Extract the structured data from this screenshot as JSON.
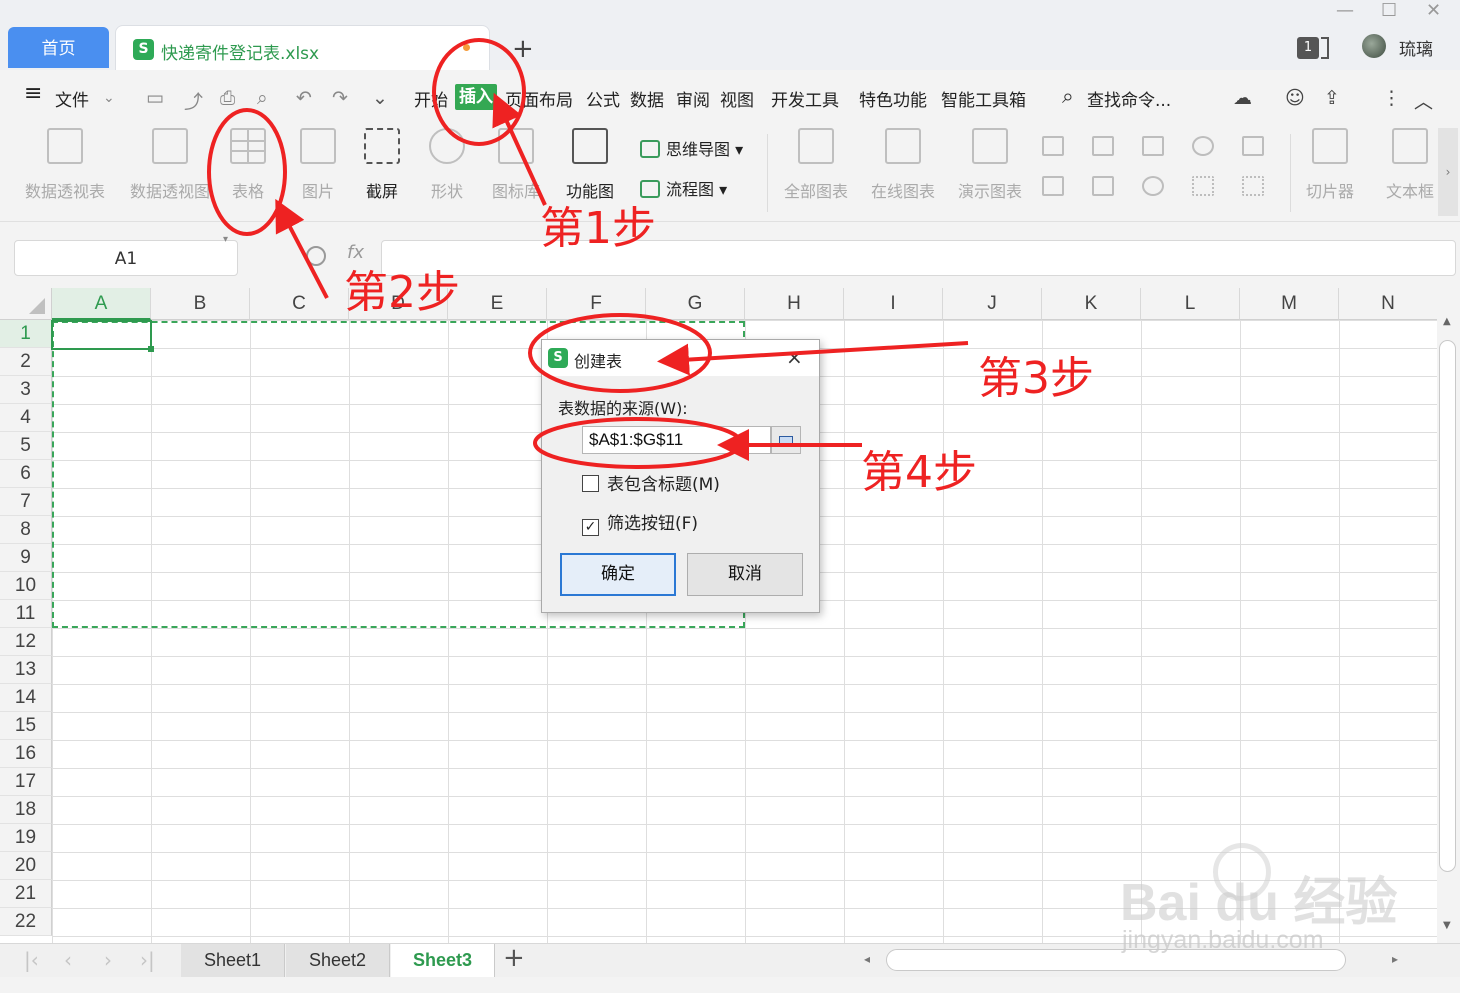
{
  "titlebar": {
    "home_tab": "首页",
    "file_tab": "快递寄件登记表.xlsx",
    "file_logo": "S",
    "add_tab": "+",
    "window_count": "1",
    "username": "琉璃"
  },
  "menu": {
    "hamburger": "≡",
    "file": "文件",
    "items": [
      "开始",
      "插入",
      "页面布局",
      "公式",
      "数据",
      "审阅",
      "视图",
      "开发工具",
      "特色功能",
      "智能工具箱"
    ],
    "search": "查找命令..."
  },
  "ribbon": {
    "buttons": [
      "数据透视表",
      "数据透视图",
      "表格",
      "图片",
      "截屏",
      "形状",
      "图标库",
      "功能图"
    ],
    "mindmap": "思维导图",
    "flowchart": "流程图",
    "chart_buttons": [
      "全部图表",
      "在线图表",
      "演示图表"
    ],
    "slicer": "切片器",
    "textbox": "文本框"
  },
  "formula": {
    "name_box": "A1",
    "fx_label": "fx",
    "value": ""
  },
  "grid": {
    "columns": [
      "A",
      "B",
      "C",
      "D",
      "E",
      "F",
      "G",
      "H",
      "I",
      "J",
      "K",
      "L",
      "M",
      "N"
    ],
    "rows": [
      "1",
      "2",
      "3",
      "4",
      "5",
      "6",
      "7",
      "8",
      "9",
      "10",
      "11",
      "12",
      "13",
      "14",
      "15",
      "16",
      "17",
      "18",
      "19",
      "20",
      "21",
      "22"
    ],
    "active_cell": "A1",
    "selection_range": "A1:G11"
  },
  "dialog": {
    "logo": "S",
    "title": "创建表",
    "close": "×",
    "source_label": "表数据的来源(W):",
    "source_value": "$A$1:$G$11",
    "has_header_label": "表包含标题(M)",
    "has_header_checked": false,
    "filter_label": "筛选按钮(F)",
    "filter_checked": true,
    "check_mark": "✓",
    "ok": "确定",
    "cancel": "取消"
  },
  "sheets": {
    "tabs": [
      "Sheet1",
      "Sheet2",
      "Sheet3"
    ],
    "active": "Sheet3",
    "add": "+"
  },
  "annotations": {
    "step1": "第1步",
    "step2": "第2步",
    "step3": "第3步",
    "step4": "第4步",
    "color": "#ee2222"
  },
  "watermark": {
    "line1": "Bai du 经验",
    "line2": "jingyan.baidu.com"
  },
  "colors": {
    "accent_green": "#2e9a4f",
    "home_blue": "#4a8ff0",
    "active_menu": "#34a853"
  }
}
